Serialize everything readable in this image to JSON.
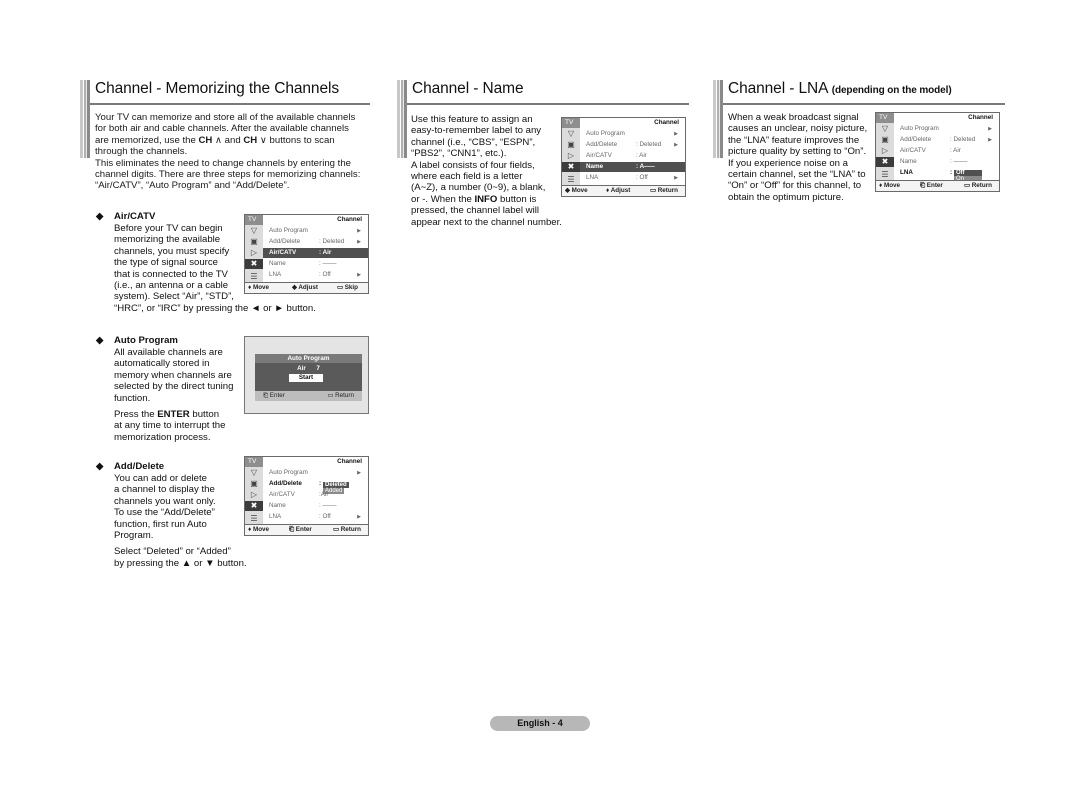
{
  "sections": {
    "memorizing": {
      "title": "Channel - Memorizing the Channels",
      "intro_1": "Your TV can memorize and store all of the available channels",
      "intro_2": "for both air and cable channels. After the available channels",
      "intro_3_pre": "are memorized, use the ",
      "intro_3_ch1": "CH",
      "intro_3_up": " ∧ and ",
      "intro_3_ch2": "CH",
      "intro_3_post": " ∨ buttons to scan",
      "intro_4": "through the channels.",
      "intro_5": "This eliminates the need to change channels by entering the",
      "intro_6": "channel digits. There are three steps for memorizing channels:",
      "intro_7": "“Air/CATV”, “Auto Program” and “Add/Delete”.",
      "bullets": [
        {
          "heading": "Air/CATV",
          "lines": [
            "Before your TV can begin",
            "memorizing the available",
            "channels, you must specify",
            "the type of signal source",
            "that is connected to the TV",
            "(i.e., an antenna or a cable",
            "system). Select “Air”, “STD”,",
            "“HRC”, or “IRC” by pressing the ◄ or ► button."
          ]
        },
        {
          "heading": "Auto Program",
          "lines": [
            "All available channels are",
            "automatically stored in",
            "memory when channels are",
            "selected by the direct tuning",
            "function."
          ],
          "extra_pre": "Press the ",
          "extra_bold": "ENTER",
          "extra_post": " button",
          "extra_lines": [
            "at any time to interrupt the",
            "memorization process."
          ]
        },
        {
          "heading": "Add/Delete",
          "lines": [
            "You can add or delete",
            "a channel to display the",
            "channels you want only.",
            "To use the “Add/Delete”",
            "function, first run Auto",
            "Program."
          ],
          "extra_lines": [
            "Select “Deleted” or “Added”",
            "by pressing the ▲ or ▼ button."
          ]
        }
      ]
    },
    "name": {
      "title": "Channel - Name",
      "lines": [
        "Use this feature to assign an",
        "easy-to-remember label to any",
        "channel (i.e., “CBS”, “ESPN”,",
        "“PBS2”, “CNN1”, etc.).",
        "A label consists of four fields,",
        "where each field is a letter",
        "(A~Z), a number (0~9), a blank,"
      ],
      "line_info_pre": "or -. When the ",
      "line_info_bold": "INFO",
      "line_info_post": " button is",
      "lines_after": [
        "pressed, the channel label will",
        "appear next to the channel number."
      ]
    },
    "lna": {
      "title": "Channel - LNA",
      "subtitle": "(depending on the model)",
      "lines": [
        "When a weak broadcast signal",
        "causes an unclear, noisy picture,",
        "the “LNA” feature improves the",
        "picture quality by setting to “On”.",
        "If you experience noise on a",
        "certain channel, set the “LNA” to",
        "“On” or “Off” for this channel, to",
        "obtain the optimum picture."
      ]
    }
  },
  "osd_common": {
    "tv_tab": "TV",
    "header": "Channel",
    "rows": [
      "Auto Program",
      "Add/Delete",
      "Air/CATV",
      "Name",
      "LNA"
    ],
    "val_deleted": ": Deleted",
    "val_air": ": Air",
    "val_name": ": ‒‒‒‒",
    "val_off": ": Off",
    "arrow": "▶",
    "icons": [
      "antenna-icon",
      "picture-icon",
      "sound-icon",
      "channel-icon",
      "setup-icon"
    ]
  },
  "osd_aircatv": {
    "footer": [
      "♦ Move",
      "◆ Adjust",
      "▭ Skip"
    ]
  },
  "osd_auto": {
    "title": "Auto Program",
    "source": "Air",
    "channel": "7",
    "start": "Start",
    "footer_enter": "⎗ Enter",
    "footer_return": "▭ Return"
  },
  "osd_adddelete": {
    "val_air": ":Air",
    "pop_selected": "Deleted",
    "pop_other": "Added",
    "footer": [
      "♦ Move",
      "⎗ Enter",
      "▭ Return"
    ]
  },
  "osd_name": {
    "name_value": "A‒‒‒",
    "footer": [
      "◆ Move",
      "♦ Adjust",
      "▭ Return"
    ]
  },
  "osd_lna": {
    "pop_selected": "Off",
    "pop_other": "On",
    "footer": [
      "♦ Move",
      "⎗ Enter",
      "▭ Return"
    ]
  },
  "page_label": "English - 4"
}
